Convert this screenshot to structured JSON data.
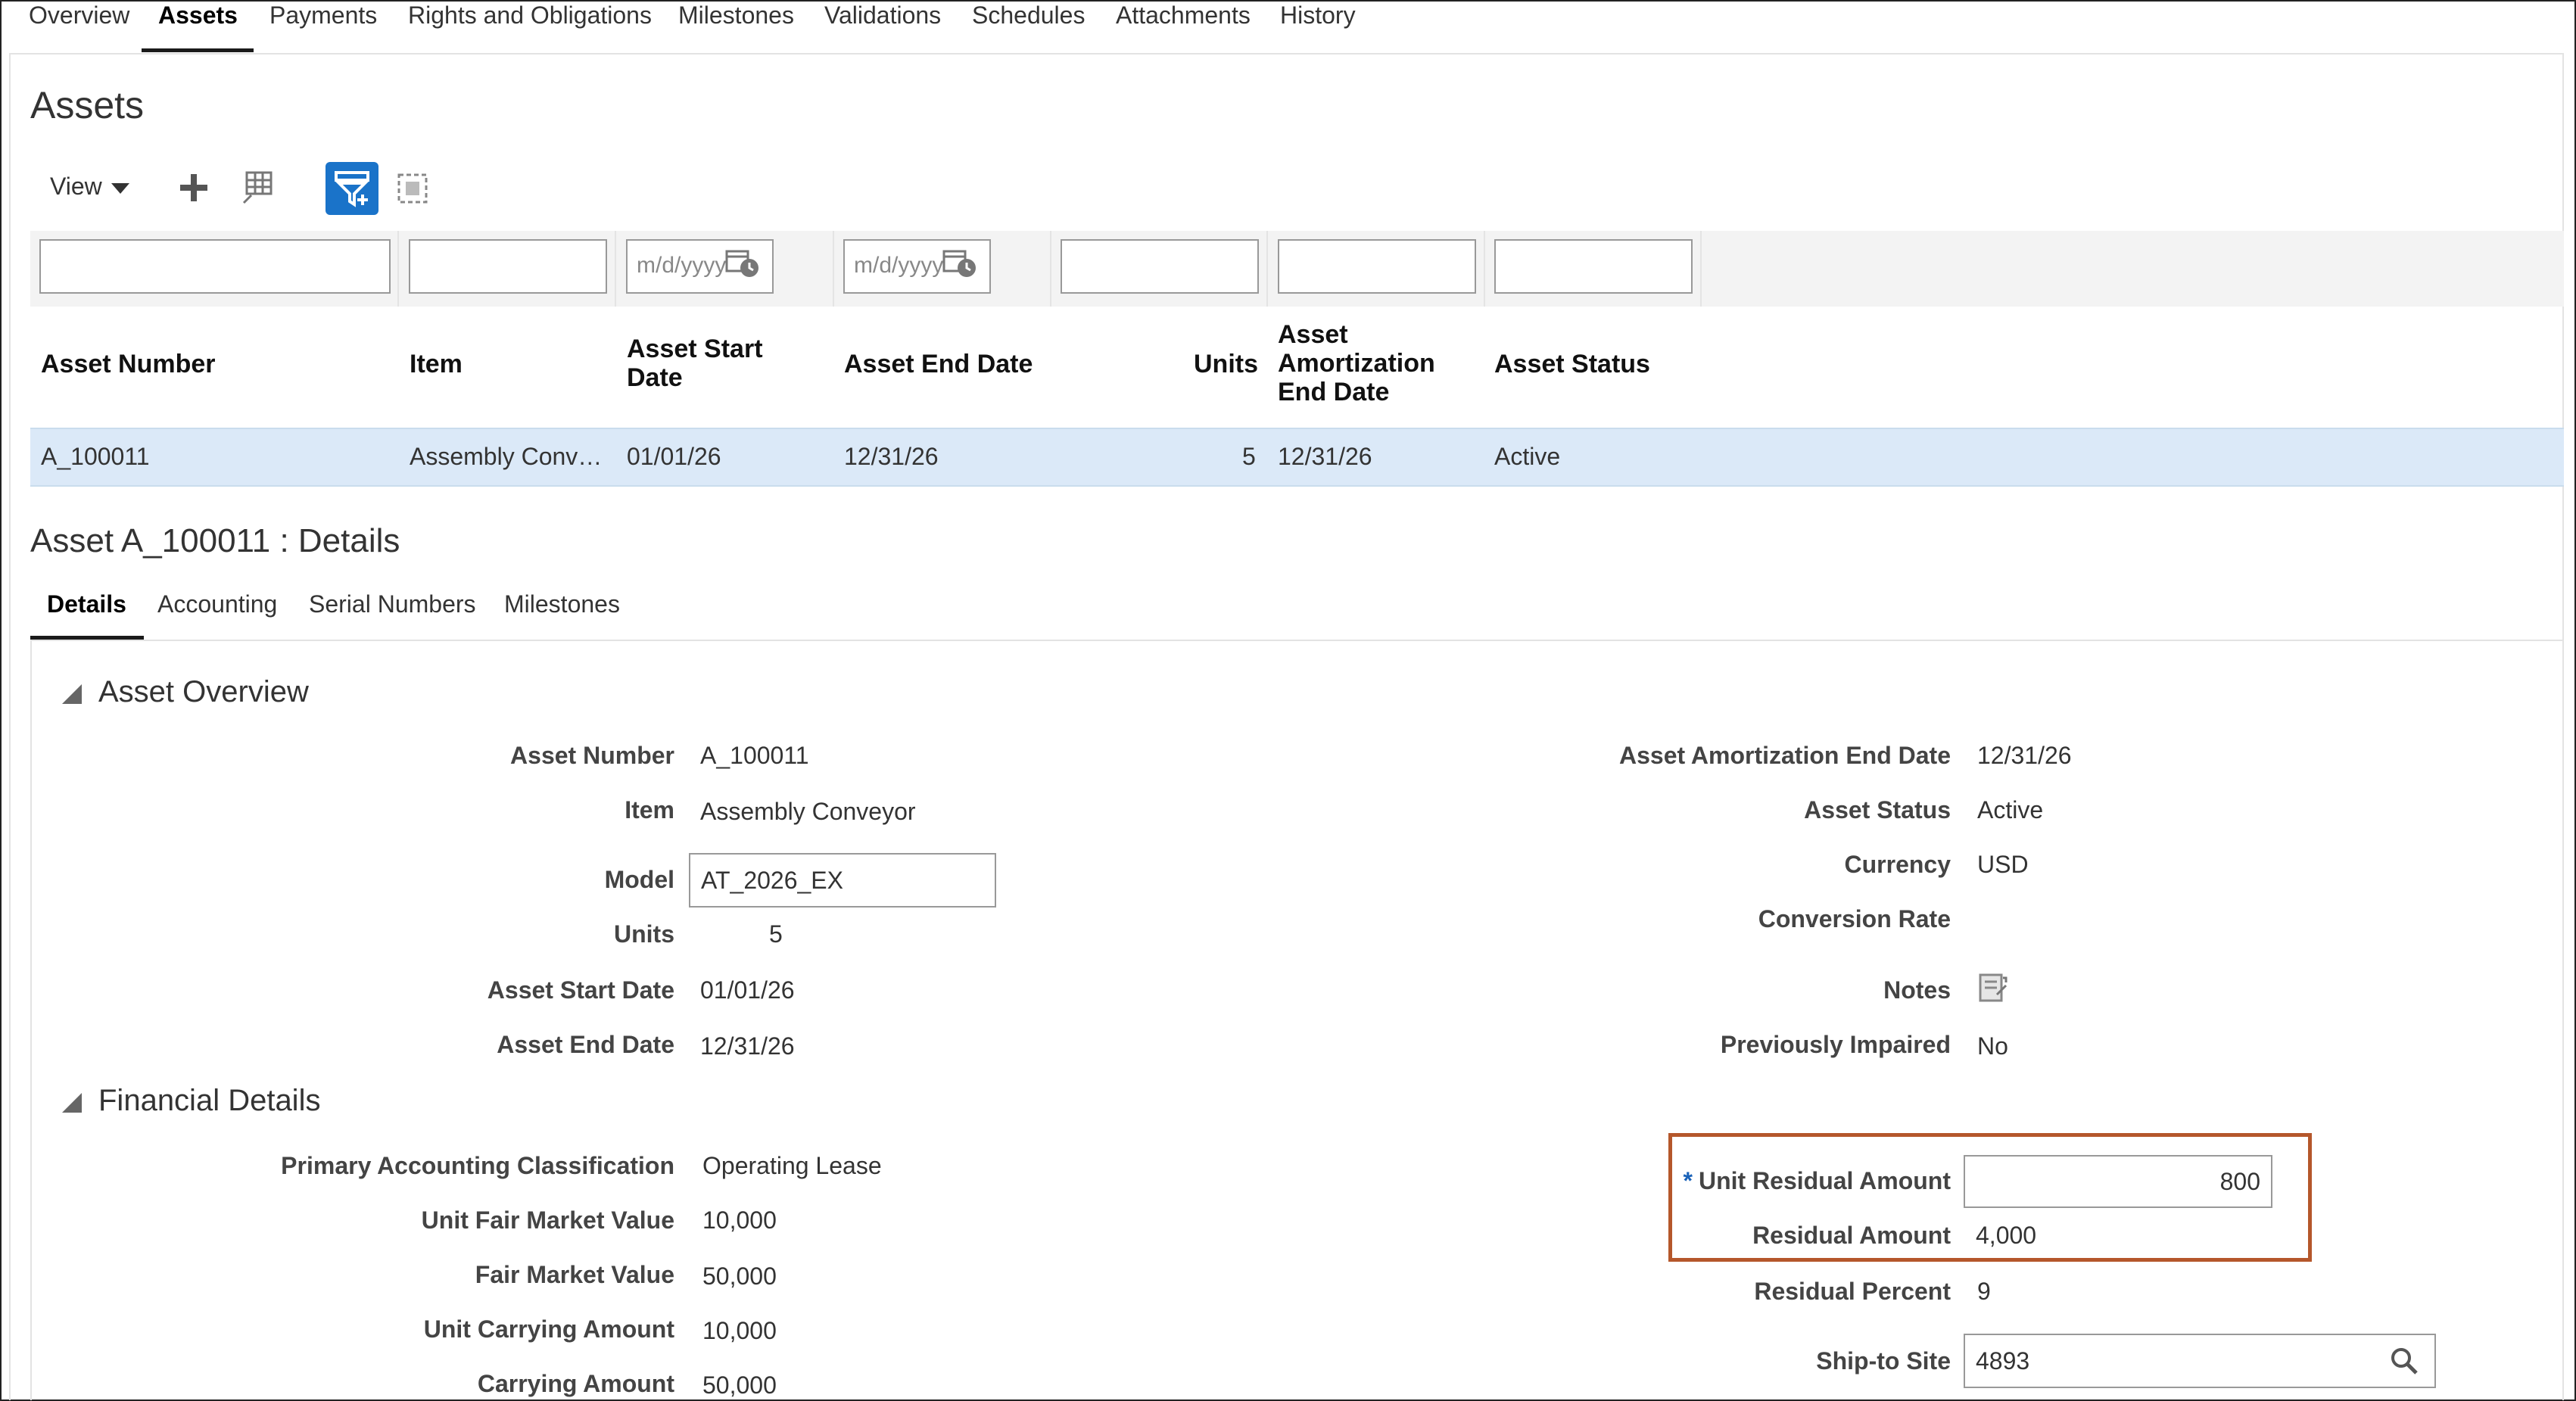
{
  "tabs": [
    "Overview",
    "Assets",
    "Payments",
    "Rights and Obligations",
    "Milestones",
    "Validations",
    "Schedules",
    "Attachments",
    "History"
  ],
  "active_tab": "Assets",
  "page_title": "Assets",
  "toolbar": {
    "view_label": "View",
    "icons": [
      "add-icon",
      "freeze-columns-icon",
      "query-by-example-icon",
      "detach-icon"
    ]
  },
  "filters": {
    "start_date_placeholder": "m/d/yyyy",
    "end_date_placeholder": "m/d/yyyy"
  },
  "table": {
    "headers": {
      "asset_number": "Asset Number",
      "item": "Item",
      "start_date_1": "Asset Start",
      "start_date_2": "Date",
      "end_date": "Asset End Date",
      "units": "Units",
      "amort_1": "Asset",
      "amort_2": "Amortization",
      "amort_3": "End Date",
      "status": "Asset Status"
    },
    "row": {
      "asset_number": "A_100011",
      "item": "Assembly Conv…",
      "start_date": "01/01/26",
      "end_date": "12/31/26",
      "units": "5",
      "amort_end": "12/31/26",
      "status": "Active"
    }
  },
  "details": {
    "heading": "Asset A_100011 : Details",
    "subtabs": [
      "Details",
      "Accounting",
      "Serial Numbers",
      "Milestones"
    ],
    "asset_overview": {
      "title": "Asset Overview",
      "asset_number_label": "Asset Number",
      "asset_number": "A_100011",
      "item_label": "Item",
      "item": "Assembly Conveyor",
      "model_label": "Model",
      "model": "AT_2026_EX",
      "units_label": "Units",
      "units": "5",
      "start_label": "Asset Start Date",
      "start": "01/01/26",
      "end_label": "Asset End Date",
      "end": "12/31/26",
      "amort_label": "Asset Amortization End Date",
      "amort": "12/31/26",
      "status_label": "Asset Status",
      "status": "Active",
      "currency_label": "Currency",
      "currency": "USD",
      "conversion_label": "Conversion Rate",
      "notes_label": "Notes",
      "impaired_label": "Previously Impaired",
      "impaired": "No"
    },
    "financial": {
      "title": "Financial Details",
      "pac_label": "Primary Accounting Classification",
      "pac": "Operating Lease",
      "ufmv_label": "Unit Fair Market Value",
      "ufmv": "10,000",
      "fmv_label": "Fair Market Value",
      "fmv": "50,000",
      "uca_label": "Unit Carrying Amount",
      "uca": "10,000",
      "ca_label": "Carrying Amount",
      "ca": "50,000",
      "ura_label": "Unit Residual Amount",
      "ura": "800",
      "ura_required": "*",
      "ra_label": "Residual Amount",
      "ra": "4,000",
      "rp_label": "Residual Percent",
      "rp": "9",
      "ship_label": "Ship-to Site",
      "ship": "4893"
    }
  },
  "colors": {
    "selected_row": "#dbe9f8",
    "accent": "#1a73c9",
    "highlight_box": "#b5572b"
  }
}
